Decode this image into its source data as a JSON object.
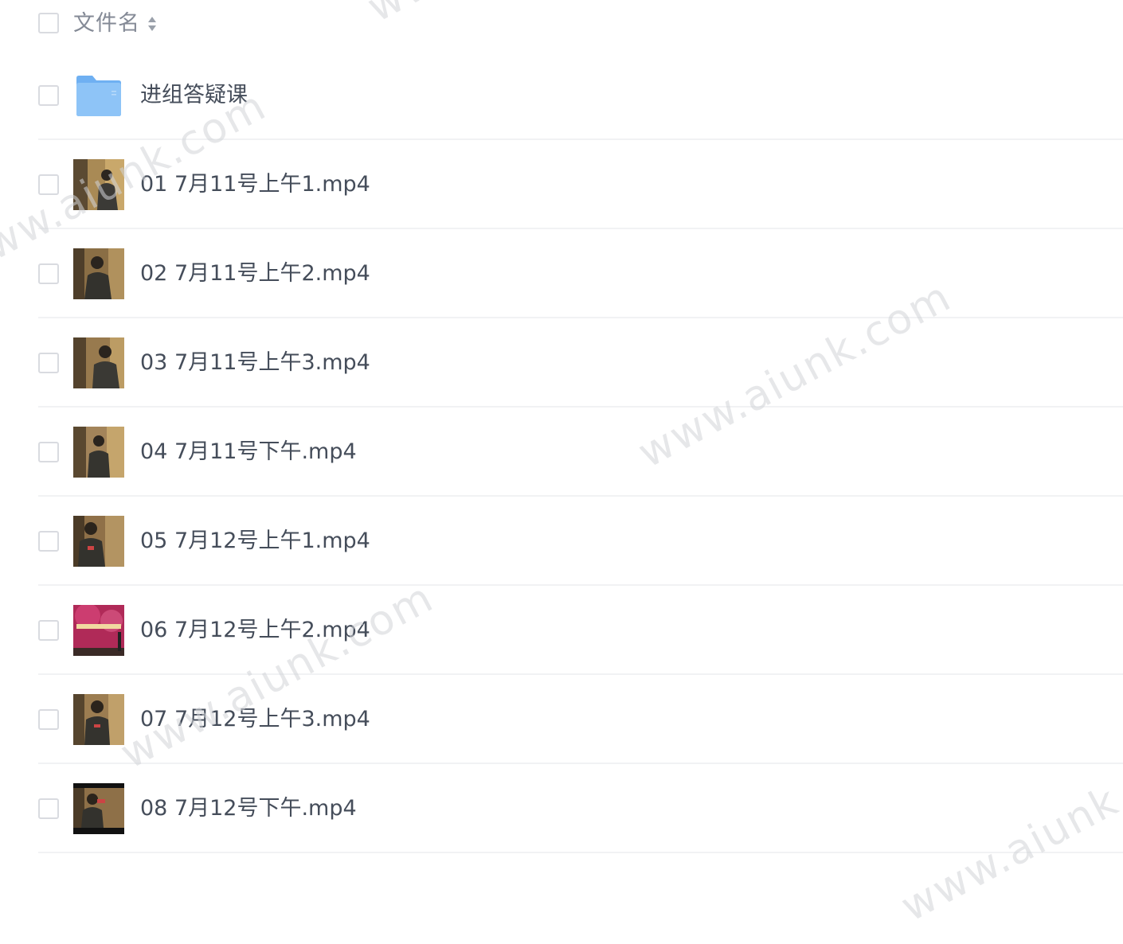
{
  "header": {
    "column_label": "文件名"
  },
  "files": [
    {
      "name": "进组答疑课",
      "type": "folder"
    },
    {
      "name": "01 7月11号上午1.mp4",
      "type": "video"
    },
    {
      "name": "02 7月11号上午2.mp4",
      "type": "video"
    },
    {
      "name": "03 7月11号上午3.mp4",
      "type": "video"
    },
    {
      "name": "04 7月11号下午.mp4",
      "type": "video"
    },
    {
      "name": "05 7月12号上午1.mp4",
      "type": "video"
    },
    {
      "name": "06 7月12号上午2.mp4",
      "type": "video"
    },
    {
      "name": "07 7月12号上午3.mp4",
      "type": "video"
    },
    {
      "name": "08 7月12号下午.mp4",
      "type": "video"
    }
  ],
  "watermarks": [
    "www.aiunk.com",
    "www.aiunk.com",
    "www.aiunk.com",
    "www.aiunk.com",
    "www.aiunk.com"
  ],
  "colors": {
    "text": "#454d5a",
    "header_text": "#848a96",
    "folder": "#7fb8f4",
    "checkbox_border": "#d9dbe0",
    "divider": "#f1f2f4"
  }
}
